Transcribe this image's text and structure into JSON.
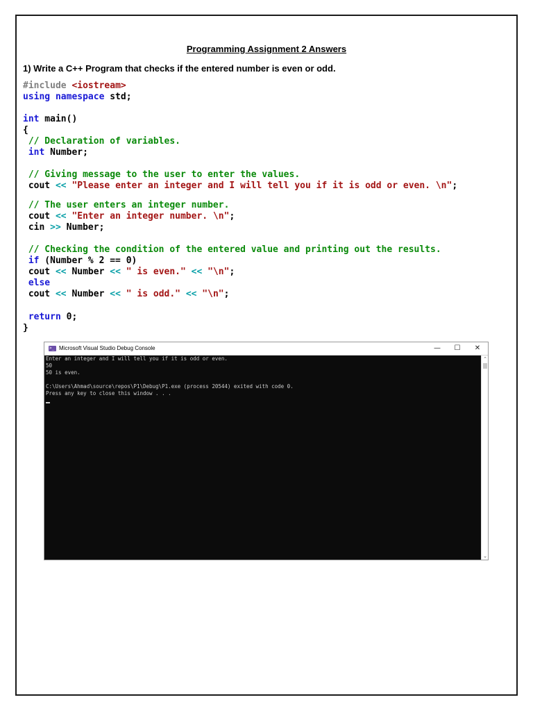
{
  "document": {
    "title": "Programming Assignment 2 Answers",
    "question": "1) Write a C++ Program that checks if the entered number is even or odd."
  },
  "code": {
    "include_directive": "#include",
    "include_header": "<iostream>",
    "using_kw": "using namespace",
    "using_rest": " std;",
    "int_kw": "int",
    "main_sig": " main()",
    "open_brace": "{",
    "comment_decl": " // Declaration of variables.",
    "decl_int": "int",
    "decl_var": " Number;",
    "comment_msg": " // Giving message to the user to enter the values.",
    "cout1_a": " cout ",
    "op_ins": "<<",
    "cout1_str": " \"Please enter an integer and I will tell you if it is odd or even. \\n\"",
    "semicolon": ";",
    "comment_user": " // The user enters an integer number.",
    "cout2_str": " \"Enter an integer number. \\n\"",
    "cin_a": " cin ",
    "op_ext": ">>",
    "cin_rest": " Number;",
    "comment_check": " // Checking the condition of the entered value and printing out the results.",
    "if_kw": "if",
    "if_cond": " (Number % 2 == 0)",
    "number_word": " Number ",
    "str_even": " \" is even.\" ",
    "str_nl": " \"\\n\"",
    "else_kw": "else",
    "str_odd": " \" is odd.\" ",
    "return_kw": "return",
    "return_val": " 0;",
    "close_brace": "}"
  },
  "console": {
    "window_title": "Microsoft Visual Studio Debug Console",
    "icon_name": "visual-studio-icon",
    "minimize": "—",
    "maximize": "☐",
    "close": "✕",
    "lines": [
      "Enter an integer and I will tell you if it is odd or even.",
      "50",
      "50 is even.",
      "",
      "C:\\Users\\Ahmad\\source\\repos\\P1\\Debug\\P1.exe (process 20544) exited with code 0.",
      "Press any key to close this window . . ."
    ],
    "scroll_up": "⌃",
    "scroll_down": "⌄"
  }
}
